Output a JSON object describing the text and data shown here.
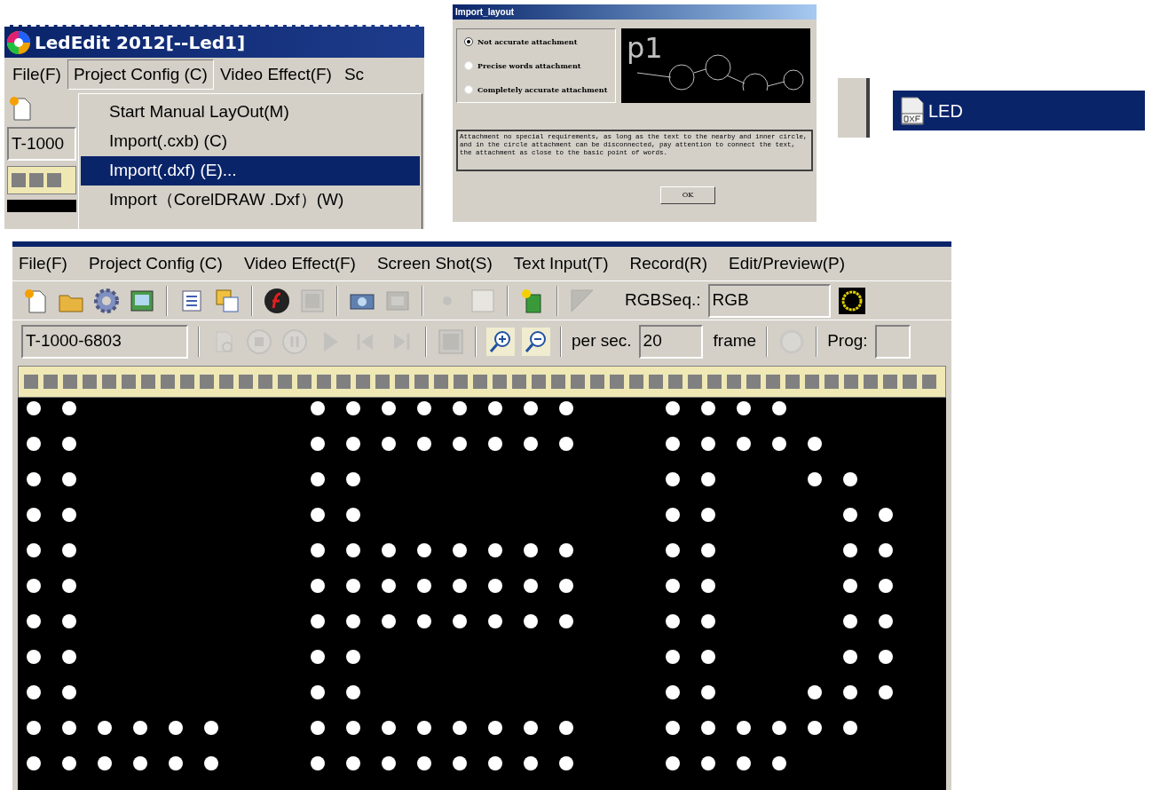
{
  "main_window": {
    "title": "LedEdit 2012[--Led1]",
    "menu": [
      {
        "label": "File(F)",
        "selected": false
      },
      {
        "label": "Project Config (C)",
        "selected": true
      },
      {
        "label": "Video Effect(F)",
        "selected": false
      },
      {
        "label": "Sc",
        "selected": false
      }
    ],
    "dropdown": [
      {
        "label": "Start Manual LayOut(M)",
        "selected": false
      },
      {
        "label": "Import(.cxb) (C)",
        "selected": false
      },
      {
        "label": "Import(.dxf) (E)...",
        "selected": true
      },
      {
        "label": "Import（CorelDRAW .Dxf）(W)",
        "selected": false
      }
    ],
    "program_field": "T-1000"
  },
  "import_dialog": {
    "title": "Import_layout",
    "options": [
      {
        "label": "Not accurate attachment",
        "selected": true
      },
      {
        "label": "Precise words attachment",
        "selected": false
      },
      {
        "label": "Completely accurate attachment",
        "selected": false
      }
    ],
    "preview_label": "p1",
    "description": "Attachment no special requirements, as long as the text to the nearby and inner circle, and in the circle attachment can be disconnected, pay attention to connect the text, the attachment as close to the basic point of words.",
    "ok_button": "OK"
  },
  "file_list": {
    "items": [
      {
        "label": "LED",
        "selected": true
      }
    ]
  },
  "editor": {
    "menu": [
      {
        "label": "File(F)",
        "selected": false
      },
      {
        "label": "Project Config (C)",
        "selected": false
      },
      {
        "label": "Video Effect(F)",
        "selected": false
      },
      {
        "label": "Screen Shot(S)",
        "selected": false
      },
      {
        "label": "Text Input(T)",
        "selected": false
      },
      {
        "label": "Record(R)",
        "selected": false
      },
      {
        "label": "Edit/Preview(P)",
        "selected": false
      }
    ],
    "rgb_label": "RGBSeq.:",
    "rgb_value": "RGB",
    "program_field": "T-1000-6803",
    "per_sec_label": "per sec.",
    "per_sec_value": "20",
    "frame_label": "frame",
    "prog_label": "Prog:"
  }
}
